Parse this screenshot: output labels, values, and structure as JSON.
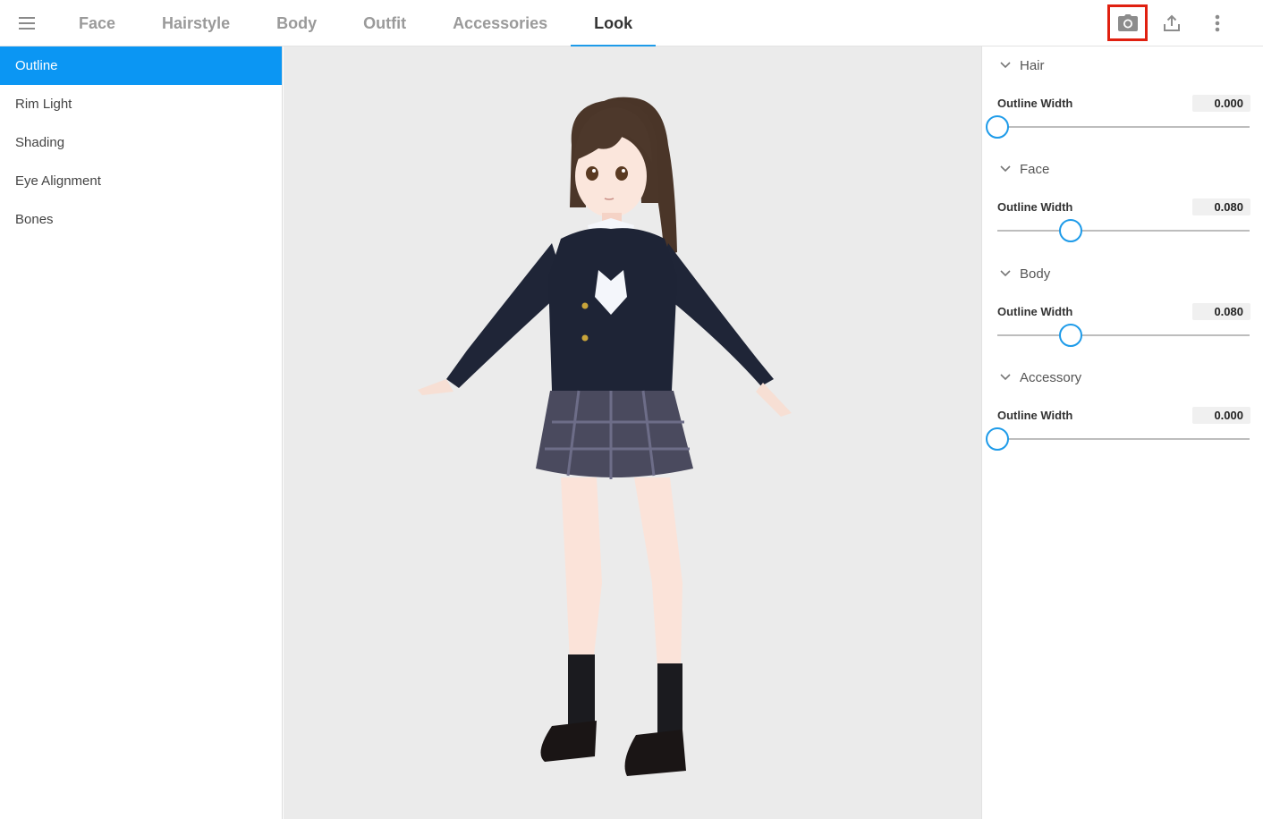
{
  "topbar": {
    "tabs": [
      {
        "label": "Face",
        "active": false
      },
      {
        "label": "Hairstyle",
        "active": false
      },
      {
        "label": "Body",
        "active": false
      },
      {
        "label": "Outfit",
        "active": false
      },
      {
        "label": "Accessories",
        "active": false
      },
      {
        "label": "Look",
        "active": true
      }
    ],
    "tools": [
      "camera-icon",
      "share-upload-icon",
      "more-vertical-icon"
    ],
    "accent_color": "#1e9be9",
    "highlight_color": "#e02010"
  },
  "sidebar": {
    "items": [
      {
        "label": "Outline",
        "active": true
      },
      {
        "label": "Rim Light",
        "active": false
      },
      {
        "label": "Shading",
        "active": false
      },
      {
        "label": "Eye Alignment",
        "active": false
      },
      {
        "label": "Bones",
        "active": false
      }
    ],
    "active_color": "#0b96f3"
  },
  "panel": {
    "sections": [
      {
        "title": "Hair",
        "slider_label": "Outline Width",
        "value": "0.000",
        "fraction": 0.0
      },
      {
        "title": "Face",
        "slider_label": "Outline Width",
        "value": "0.080",
        "fraction": 0.29
      },
      {
        "title": "Body",
        "slider_label": "Outline Width",
        "value": "0.080",
        "fraction": 0.29
      },
      {
        "title": "Accessory",
        "slider_label": "Outline Width",
        "value": "0.000",
        "fraction": 0.0
      }
    ]
  }
}
